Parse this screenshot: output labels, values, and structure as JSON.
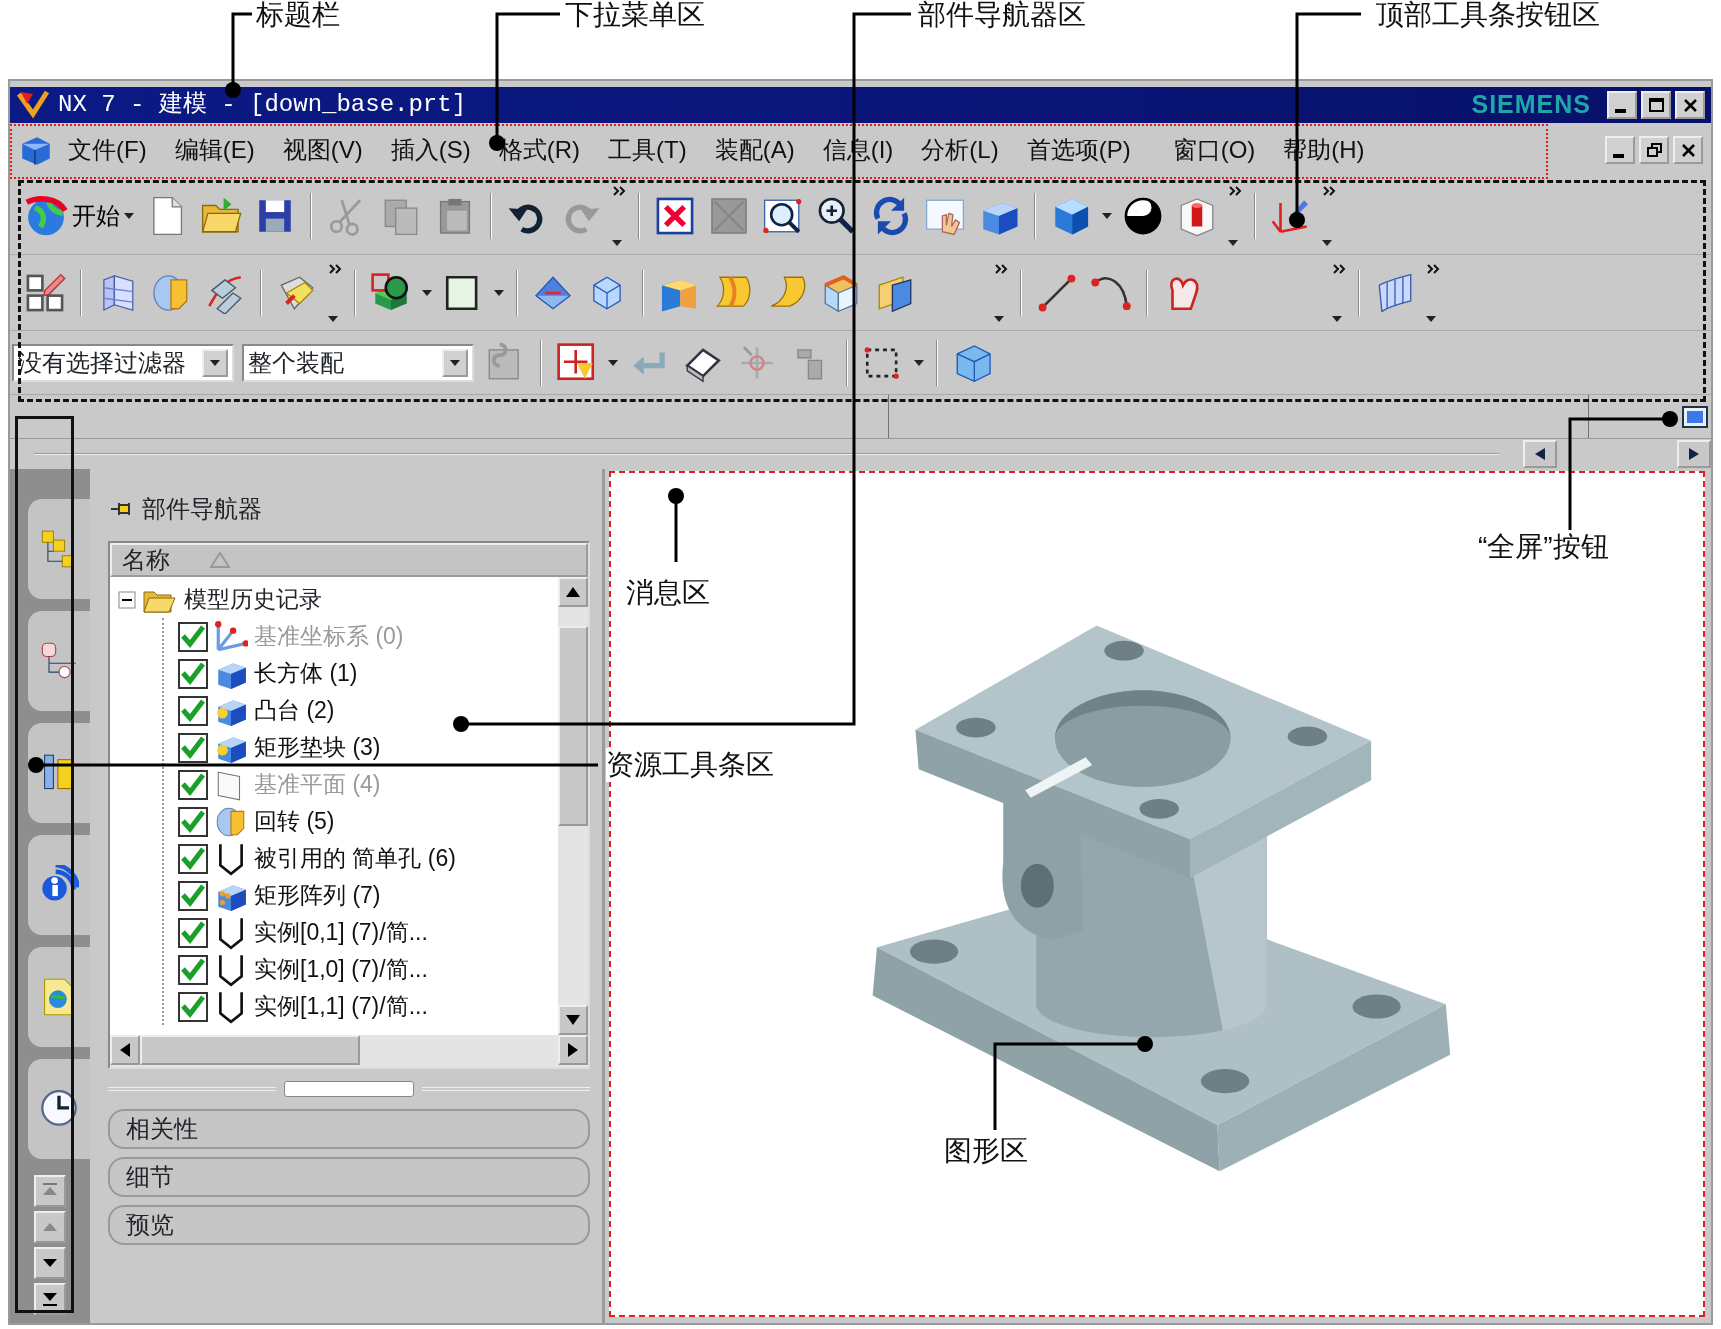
{
  "callouts": [
    {
      "label": "标题栏"
    },
    {
      "label": "下拉菜单区"
    },
    {
      "label": "部件导航器区"
    },
    {
      "label": "顶部工具条按钮区"
    },
    {
      "label": "消息区"
    },
    {
      "label": "“全屏”按钮"
    },
    {
      "label": "资源工具条区"
    },
    {
      "label": "图形区"
    }
  ],
  "window": {
    "title": "NX 7 - 建模 - [down_base.prt]",
    "brand": "SIEMENS"
  },
  "menu": [
    "文件(F)",
    "编辑(E)",
    "视图(V)",
    "插入(S)",
    "格式(R)",
    "工具(T)",
    "装配(A)",
    "信息(I)",
    "分析(L)",
    "首选项(P)",
    "窗口(O)",
    "帮助(H)"
  ],
  "toolbar": {
    "start_button": "开始",
    "selection_filter": "没有选择过滤器",
    "scope": "整个装配"
  },
  "part_navigator": {
    "title": "部件导航器",
    "column": "名称",
    "root": {
      "label": "模型历史记录",
      "expanded": true,
      "children": [
        {
          "label": "基准坐标系 (0)",
          "kind": "csys",
          "checked": true,
          "dimmed": true
        },
        {
          "label": "长方体 (1)",
          "kind": "block",
          "checked": true,
          "dimmed": false
        },
        {
          "label": "凸台 (2)",
          "kind": "boss",
          "checked": true,
          "dimmed": false
        },
        {
          "label": "矩形垫块 (3)",
          "kind": "boss",
          "checked": true,
          "dimmed": false
        },
        {
          "label": "基准平面 (4)",
          "kind": "plane",
          "checked": true,
          "dimmed": true
        },
        {
          "label": "回转 (5)",
          "kind": "revolve",
          "checked": true,
          "dimmed": false
        },
        {
          "label": "被引用的 简单孔 (6)",
          "kind": "hole",
          "checked": true,
          "dimmed": false
        },
        {
          "label": "矩形阵列 (7)",
          "kind": "pattern",
          "checked": true,
          "dimmed": false
        },
        {
          "label": "实例[0,1] (7)/简...",
          "kind": "hole",
          "checked": true,
          "dimmed": false
        },
        {
          "label": "实例[1,0] (7)/简...",
          "kind": "hole",
          "checked": true,
          "dimmed": false
        },
        {
          "label": "实例[1,1] (7)/简...",
          "kind": "hole",
          "checked": true,
          "dimmed": false
        }
      ]
    }
  },
  "panels": [
    {
      "label": "相关性"
    },
    {
      "label": "细节"
    },
    {
      "label": "预览"
    }
  ]
}
